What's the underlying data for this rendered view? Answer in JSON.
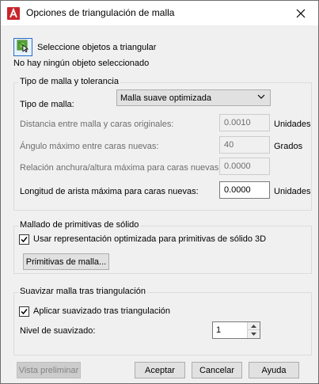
{
  "window": {
    "title": "Opciones de triangulación de malla"
  },
  "select": {
    "label": "Seleccione objetos a triangular",
    "status": "No hay ningún objeto seleccionado"
  },
  "mesh_type_group": {
    "title": "Tipo de malla y tolerancia",
    "type_label": "Tipo de malla:",
    "type_value": "Malla suave optimizada",
    "distance_label": "Distancia entre malla y caras originales:",
    "distance_value": "0.0010",
    "distance_unit": "Unidades",
    "angle_label": "Ángulo máximo entre caras nuevas:",
    "angle_value": "40",
    "angle_unit": "Grados",
    "ratio_label": "Relación anchura/altura máxima para caras nuevas:",
    "ratio_value": "0.0000",
    "edge_label": "Longitud de arista máxima para caras nuevas:",
    "edge_value": "0.0000",
    "edge_unit": "Unidades"
  },
  "primitives_group": {
    "title": "Mallado de primitivas de sólido",
    "checkbox_label": "Usar representación optimizada para primitivas de sólido 3D",
    "checkbox_checked": true,
    "button_label": "Primitivas de malla..."
  },
  "smooth_group": {
    "title": "Suavizar malla tras triangulación",
    "checkbox_label": "Aplicar suavizado tras triangulación",
    "checkbox_checked": true,
    "level_label": "Nivel de suavizado:",
    "level_value": "1"
  },
  "buttons": {
    "preview": "Vista preliminar",
    "accept": "Aceptar",
    "cancel": "Cancelar",
    "help": "Ayuda"
  }
}
